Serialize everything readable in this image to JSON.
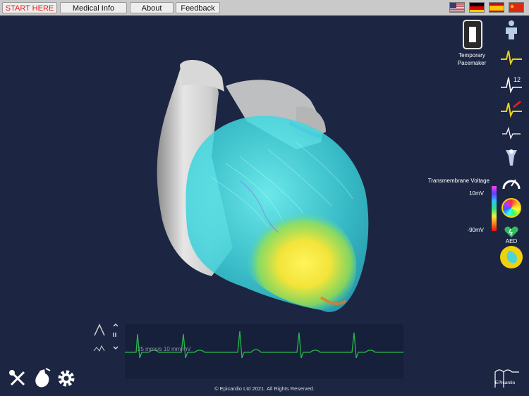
{
  "topbar": {
    "start_label": "START HERE",
    "medical_label": "Medical Info",
    "about_label": "About",
    "feedback_label": "Feedback",
    "flags": [
      "us-flag-icon",
      "de-flag-icon",
      "es-flag-icon",
      "cn-flag-icon"
    ]
  },
  "pacemaker": {
    "label_line1": "Temporary",
    "label_line2": "Pacemaker"
  },
  "voltage": {
    "title": "Transmembrane Voltage",
    "max_label": "10mV",
    "min_label": "-90mV"
  },
  "aed": {
    "label": "AED"
  },
  "ecg": {
    "scale_label": "25 mms/s  10 mm/mV"
  },
  "footer": {
    "copyright": "© Epicardio Ltd 2021. All Rights Reserved."
  },
  "brand": {
    "label": "EPIcardio"
  },
  "colors": {
    "start_text": "#e0201c",
    "background": "#1c2542",
    "ecg_line": "#27b84a",
    "accent_icon": "#f0d20c"
  }
}
